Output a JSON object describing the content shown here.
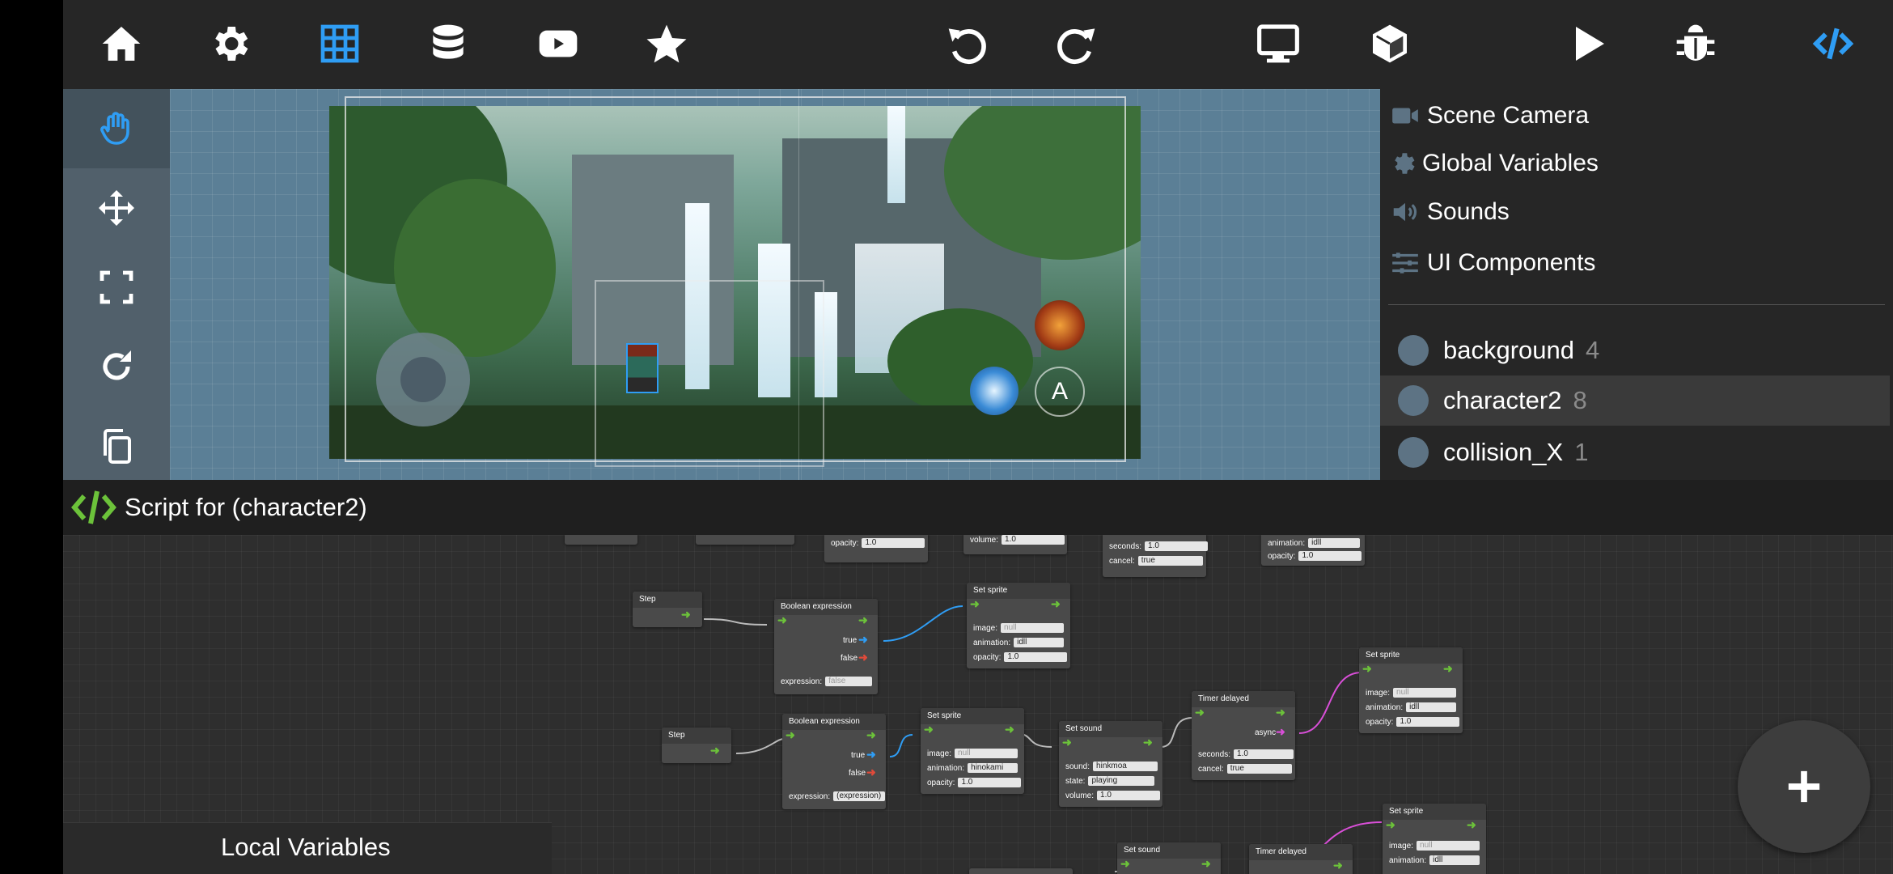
{
  "toolbar": {
    "items": [
      "home-icon",
      "gear-icon",
      "grid-icon",
      "database-icon",
      "youtube-icon",
      "star-icon",
      "undo-icon",
      "redo-icon",
      "monitor-icon",
      "cube-icon",
      "play-icon",
      "bug-icon",
      "code-icon"
    ],
    "accent": "#2f9df4"
  },
  "tools": [
    "hand-icon",
    "move-icon",
    "fullscreen-icon",
    "rotate-icon",
    "copy-icon"
  ],
  "right_panel": {
    "items": [
      {
        "icon": "video-camera-icon",
        "label": "Scene Camera"
      },
      {
        "icon": "gear-icon",
        "label": "Global Variables"
      },
      {
        "icon": "speaker-icon",
        "label": "Sounds"
      },
      {
        "icon": "sliders-icon",
        "label": "UI Components"
      }
    ],
    "objects": [
      {
        "name": "background",
        "count": "4"
      },
      {
        "name": "character2",
        "count": "8"
      },
      {
        "name": "collision_X",
        "count": "1"
      }
    ]
  },
  "script": {
    "title": "Script for (character2)"
  },
  "graph": {
    "step1": "Step",
    "step2": "Step",
    "bool1": {
      "title": "Boolean expression",
      "true": "true",
      "false": "false",
      "expression_label": "expression:",
      "expression_value": "false"
    },
    "bool2": {
      "title": "Boolean expression",
      "true": "true",
      "false": "false",
      "expression_label": "expression:",
      "expression_value": "(expression)"
    },
    "sprite1": {
      "title": "Set sprite",
      "image_label": "image:",
      "image": "null",
      "animation_label": "animation:",
      "animation": "idll",
      "opacity_label": "opacity:",
      "opacity": "1.0"
    },
    "sprite2": {
      "title": "Set sprite",
      "image_label": "image:",
      "image": "null",
      "animation_label": "animation:",
      "animation": "hinokami",
      "opacity_label": "opacity:",
      "opacity": "1.0"
    },
    "sprite3": {
      "title": "Set sprite",
      "image_label": "image:",
      "image": "null",
      "animation_label": "animation:",
      "animation": "idll",
      "opacity_label": "opacity:",
      "opacity": "1.0"
    },
    "sprite4": {
      "title": "Set sprite",
      "image_label": "image:",
      "image": "null",
      "animation_label": "animation:",
      "animation": "idll"
    },
    "sound1": {
      "title": "Set sound",
      "sound_label": "sound:",
      "sound": "hinkmoa",
      "state_label": "state:",
      "state": "playing",
      "volume_label": "volume:",
      "volume": "1.0"
    },
    "sound2": {
      "title": "Set sound"
    },
    "timer1": {
      "title": "Timer delayed",
      "async": "async",
      "seconds_label": "seconds:",
      "seconds": "1.0",
      "cancel_label": "cancel:",
      "cancel": "true"
    },
    "timer2": {
      "title": "Timer delayed"
    },
    "top_fragments": {
      "opacity_label": "opacity:",
      "opacity": "1.0",
      "volume_label": "volume:",
      "volume": "1.0",
      "seconds_label": "seconds:",
      "seconds": "1.0",
      "cancel_label": "cancel:",
      "cancel": "true",
      "animation_label": "animation:",
      "animation": "idll",
      "opacity2_label": "opacity:",
      "opacity2": "1.0"
    }
  },
  "local_variables": "Local Variables",
  "fab_icon": "plus-icon"
}
